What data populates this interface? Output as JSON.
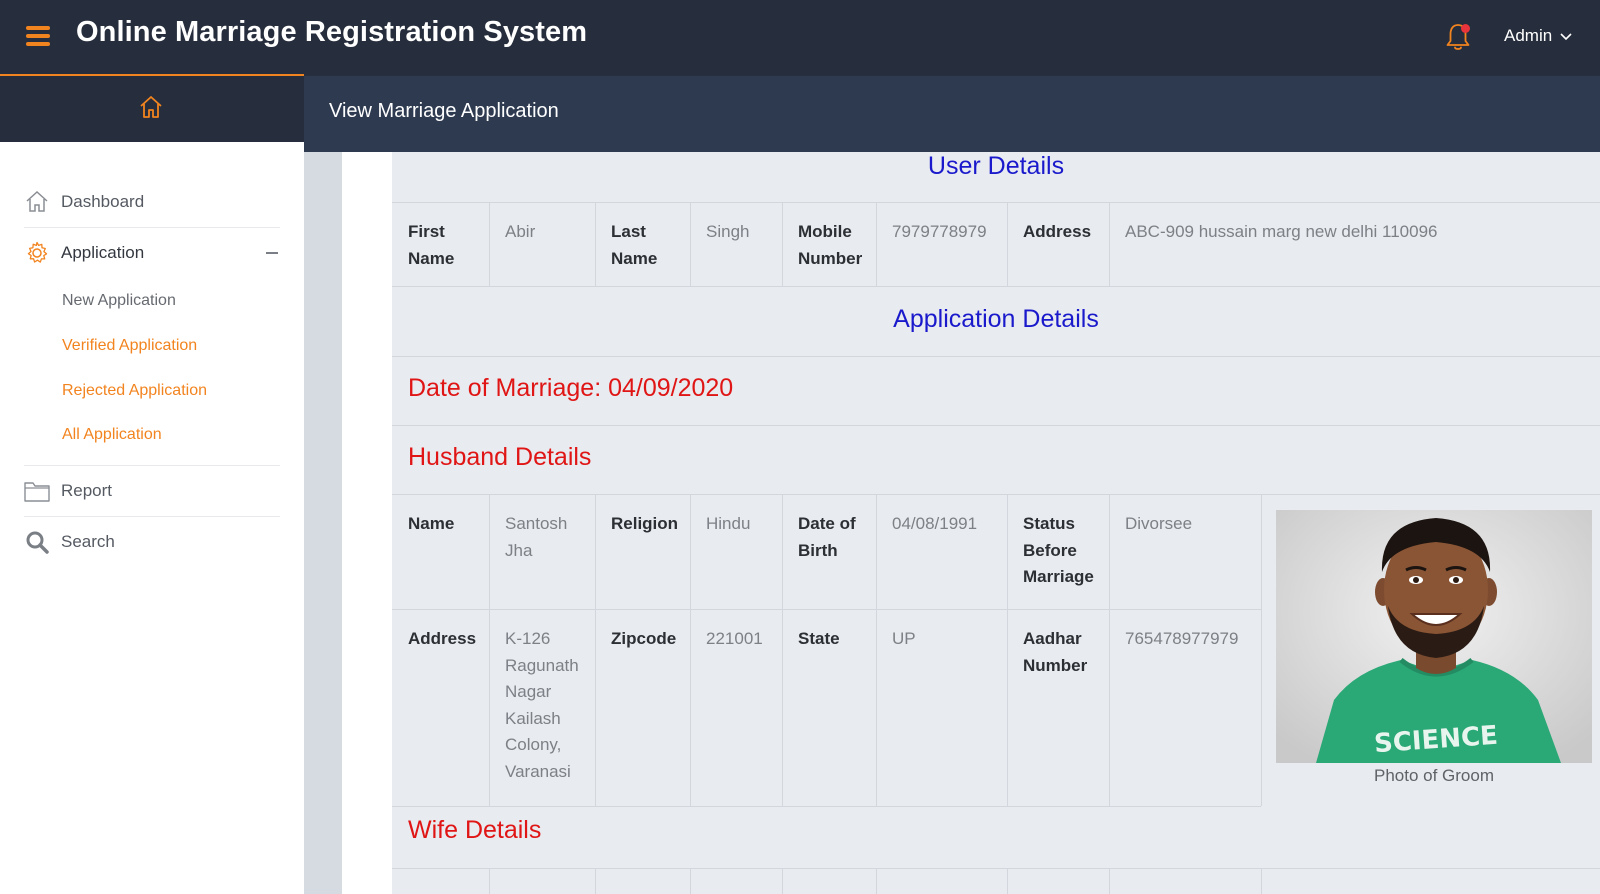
{
  "app": {
    "title": "Online Marriage Registration System",
    "user_label": "Admin",
    "page_title": "View Marriage Application",
    "accent_color": "#f2841f",
    "header_color": "#262d3c"
  },
  "sidebar": {
    "items": [
      {
        "label": "Dashboard",
        "icon": "home-icon"
      },
      {
        "label": "Application",
        "icon": "gear-icon"
      },
      {
        "label": "Report",
        "icon": "folder-icon"
      },
      {
        "label": "Search",
        "icon": "search-icon"
      }
    ],
    "sub_items": [
      {
        "label": "New Application"
      },
      {
        "label": "Verified Application"
      },
      {
        "label": "Rejected Application"
      },
      {
        "label": "All Application"
      }
    ]
  },
  "user_details": {
    "heading": "User Details",
    "first_name_label": "First Name",
    "first_name": "Abir",
    "last_name_label": "Last Name",
    "last_name": "Singh",
    "mobile_label": "Mobile Number",
    "mobile": "7979778979",
    "address_label": "Address",
    "address": "ABC-909 hussain marg new delhi 110096"
  },
  "application_details": {
    "heading": "Application Details",
    "date_of_marriage": "Date of Marriage: 04/09/2020"
  },
  "husband": {
    "heading": "Husband Details",
    "name_label": "Name",
    "name": "Santosh Jha",
    "religion_label": "Religion",
    "religion": "Hindu",
    "dob_label": "Date of Birth",
    "dob": "04/08/1991",
    "status_label": "Status Before Marriage",
    "status": "Divorsee",
    "address_label": "Address",
    "address": "K-126 Ragunath Nagar Kailash Colony, Varanasi",
    "zipcode_label": "Zipcode",
    "zipcode": "221001",
    "state_label": "State",
    "state": "UP",
    "aadhar_label": "Aadhar Number",
    "aadhar": "765478977979",
    "photo_caption": "Photo of Groom",
    "photo_shirt_text": "SCIENCE"
  },
  "wife": {
    "heading": "Wife Details"
  }
}
